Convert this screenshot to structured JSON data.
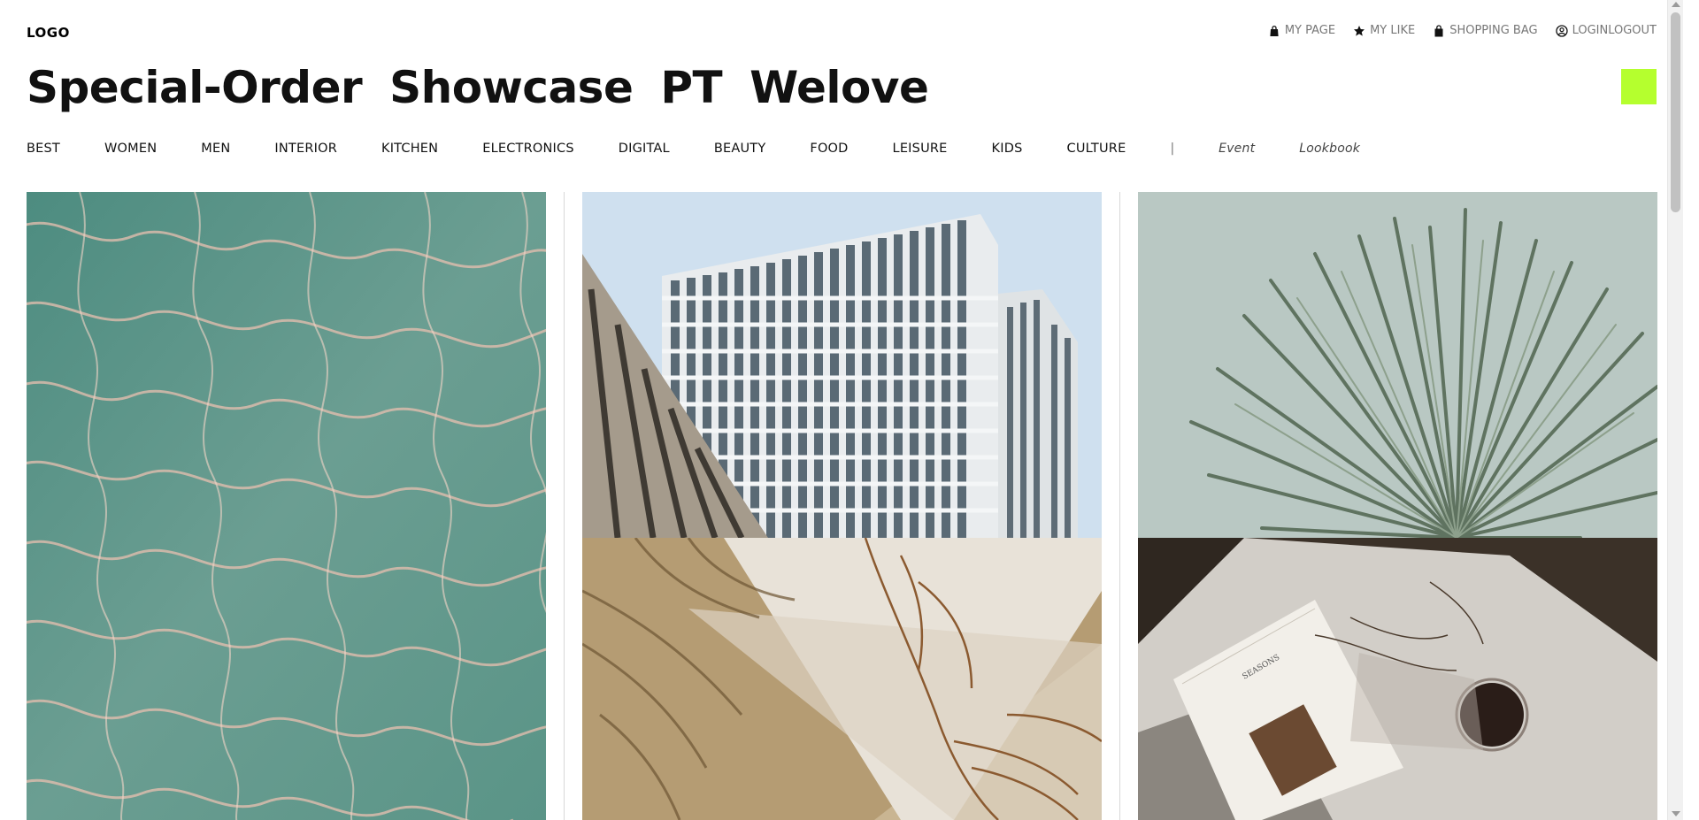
{
  "header": {
    "logo": "LOGO",
    "util_links": [
      {
        "label": "MY PAGE",
        "icon": "bag-dark-icon"
      },
      {
        "label": "MY LIKE",
        "icon": "star-icon"
      },
      {
        "label": "SHOPPING BAG",
        "icon": "shopping-bag-icon"
      },
      {
        "label": "LOGINLOGOUT",
        "icon": "user-circle-icon"
      }
    ],
    "title_words": [
      "Special-Order",
      "Showcase",
      "PT",
      "Welove"
    ],
    "accent_color": "#b5ff2e"
  },
  "nav": {
    "items": [
      "BEST",
      "WOMEN",
      "MEN",
      "INTERIOR",
      "KITCHEN",
      "ELECTRONICS",
      "DIGITAL",
      "BEAUTY",
      "FOOD",
      "LEISURE",
      "KIDS",
      "CULTURE"
    ],
    "separator": "|",
    "italic_items": [
      "Event",
      "Lookbook"
    ]
  },
  "gallery": {
    "tiles": [
      {
        "name": "water-ripple-photo",
        "subject": "sunlit rippling pool water"
      },
      {
        "name": "modern-building-photo",
        "subject": "white modern office building against sky"
      },
      {
        "name": "agave-plant-photo",
        "subject": "spiky agave plant against pale sky"
      },
      {
        "name": "palm-shadow-photo",
        "subject": "dried palm fronds casting shadows on beige wall"
      },
      {
        "name": "magazine-still-life-photo",
        "subject": "magazine with glass and dried flowers on stone table"
      }
    ],
    "magazine_cover_text": "SEASONS"
  }
}
